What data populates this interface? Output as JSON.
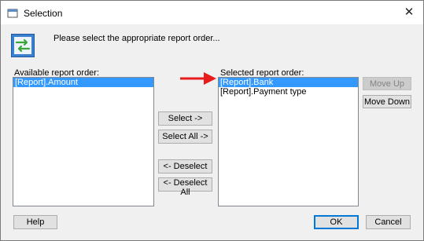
{
  "window": {
    "title": "Selection",
    "instruction": "Please select the appropriate report order..."
  },
  "available": {
    "label": "Available report order:",
    "items": [
      "[Report].Amount"
    ]
  },
  "selected": {
    "label": "Selected report order:",
    "items": [
      "[Report].Bank",
      "[Report].Payment type"
    ]
  },
  "buttons": {
    "select": "Select ->",
    "select_all": "Select All ->",
    "deselect": "<- Deselect",
    "deselect_all": "<- Deselect All",
    "move_up": "Move Up",
    "move_down": "Move Down",
    "help": "Help",
    "ok": "OK",
    "cancel": "Cancel"
  },
  "colors": {
    "selection": "#3399ff",
    "arrow": "#e81c1c",
    "default_border": "#0078d7"
  },
  "icons": {
    "app": "window-icon",
    "close": "close-icon",
    "dialog": "swap-order-icon",
    "annotation": "red-arrow-icon"
  }
}
